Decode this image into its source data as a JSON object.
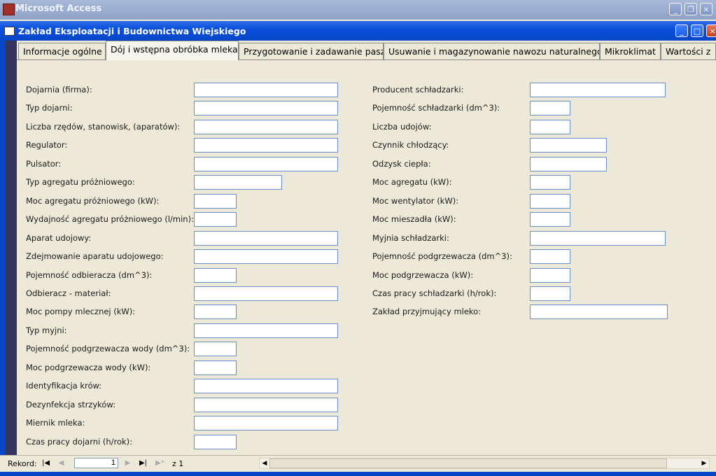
{
  "app": {
    "title": "Microsoft Access",
    "icon": "access-key-icon"
  },
  "window": {
    "title": "Zakład Eksploatacji i Budownictwa Wiejskiego"
  },
  "tabs": [
    "Informacje ogólne",
    "Dój i wstępna obróbka mleka",
    "Przygotowanie i zadawanie pasz",
    "Usuwanie i magazynowanie nawozu naturalnego",
    "Mikroklimat",
    "Wartości z"
  ],
  "active_tab": "Dój i wstępna obróbka mleka",
  "left_fields": [
    {
      "label": "Dojarnia (firma):",
      "value": ""
    },
    {
      "label": "Typ dojarni:",
      "value": ""
    },
    {
      "label": "Liczba rzędów, stanowisk, (aparatów):",
      "value": ""
    },
    {
      "label": "Regulator:",
      "value": ""
    },
    {
      "label": "Pulsator:",
      "value": ""
    },
    {
      "label": "Typ agregatu próżniowego:",
      "value": ""
    },
    {
      "label": "Moc agregatu próżniowego (kW):",
      "value": ""
    },
    {
      "label": "Wydajność agregatu próżniowego (l/min):",
      "value": ""
    },
    {
      "label": "Aparat udojowy:",
      "value": ""
    },
    {
      "label": "Zdejmowanie aparatu udojowego:",
      "value": ""
    },
    {
      "label": "Pojemność odbieracza (dm^3):",
      "value": ""
    },
    {
      "label": "Odbieracz - materiał:",
      "value": ""
    },
    {
      "label": "Moc pompy mlecznej (kW):",
      "value": ""
    },
    {
      "label": "Typ myjni:",
      "value": ""
    },
    {
      "label": "Pojemność podgrzewacza wody (dm^3):",
      "value": ""
    },
    {
      "label": "Moc podgrzewacza wody (kW):",
      "value": ""
    },
    {
      "label": "Identyfikacja krów:",
      "value": ""
    },
    {
      "label": "Dezynfekcja strzyków:",
      "value": ""
    },
    {
      "label": "Miernik mleka:",
      "value": ""
    },
    {
      "label": "Czas pracy dojarni (h/rok):",
      "value": ""
    }
  ],
  "right_fields": [
    {
      "label": "Producent schładzarki:",
      "value": ""
    },
    {
      "label": "Pojemność schładzarki (dm^3):",
      "value": ""
    },
    {
      "label": "Liczba udojów:",
      "value": ""
    },
    {
      "label": "Czynnik chłodzący:",
      "value": ""
    },
    {
      "label": "Odzysk ciepła:",
      "value": ""
    },
    {
      "label": "Moc agregatu (kW):",
      "value": ""
    },
    {
      "label": "Moc wentylator (kW):",
      "value": ""
    },
    {
      "label": "Moc mieszadła (kW):",
      "value": ""
    },
    {
      "label": "Myjnia schładzarki:",
      "value": ""
    },
    {
      "label": "Pojemność podgrzewacza (dm^3):",
      "value": ""
    },
    {
      "label": "Moc podgrzewacza (kW):",
      "value": ""
    },
    {
      "label": "Czas pracy schładzarki (h/rok):",
      "value": ""
    },
    {
      "label": "Zakład przyjmujący mleko:",
      "value": ""
    }
  ],
  "navigation": {
    "record_label": "Rekord:",
    "current_record": "1",
    "of_label": "z",
    "total": "1",
    "buttons": [
      "first-record-icon",
      "previous-record-icon",
      "next-record-icon",
      "last-record-icon",
      "new-record-icon"
    ]
  },
  "colors": {
    "titlebar_active": "#0a4fdc",
    "titlebar_inactive": "#9eb0d8",
    "field_border": "#6b8fc6",
    "form_bg": "#ece9d8",
    "selector": "#34345e"
  }
}
